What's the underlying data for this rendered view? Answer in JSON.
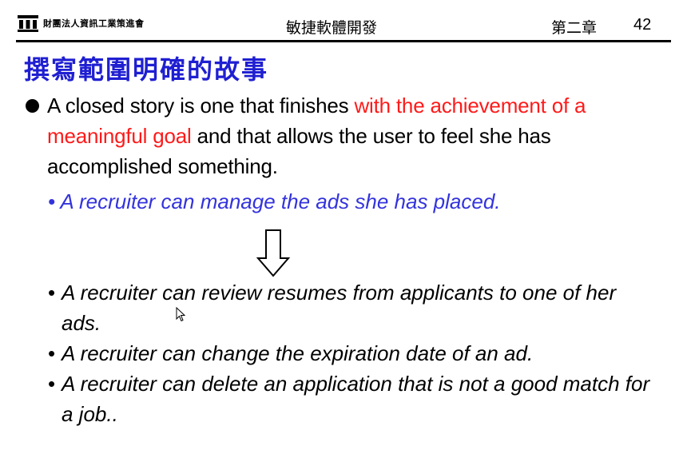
{
  "header": {
    "org_name": "財團法人資訊工業策進會",
    "deck_title": "敏捷軟體開發",
    "chapter": "第二章",
    "page_number": "42"
  },
  "slide": {
    "title": "撰寫範圍明確的故事",
    "main_bullet": {
      "text_before": "A closed story is one that finishes ",
      "highlight": "with the achievement of a meaningful goal",
      "text_after": " and that allows the user to feel she has accomplished something.",
      "highlight_color": "#ff1a1a"
    },
    "example": "A recruiter can manage the ads she has placed.",
    "example_color": "#3333dd",
    "sub_items": [
      "A recruiter can review resumes from applicants to one of her ads.",
      "A recruiter can change the expiration date of an ad.",
      "A recruiter can delete an application that is not a good match for a job.."
    ],
    "title_color": "#1f1fd2",
    "arrow_icon": "down-arrow-icon"
  }
}
